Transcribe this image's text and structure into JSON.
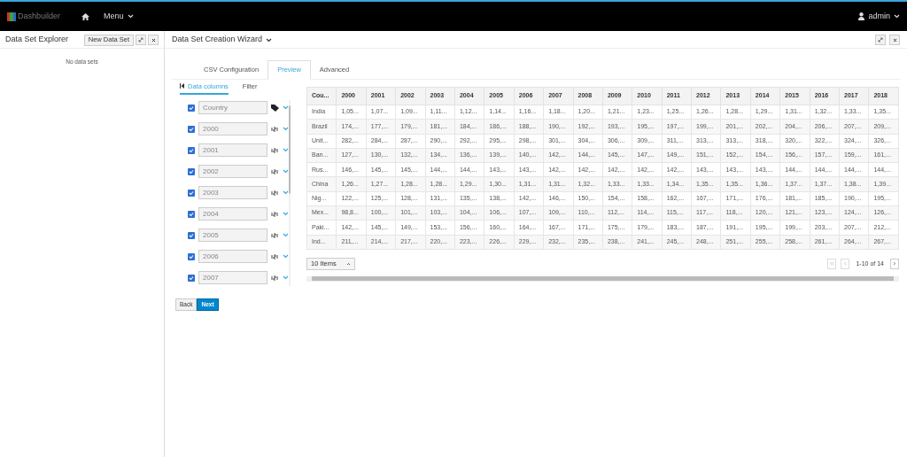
{
  "navbar": {
    "brand": "Dashbuilder",
    "menu": "Menu",
    "user": "admin"
  },
  "explorer": {
    "title": "Data Set Explorer",
    "new_button": "New Data Set",
    "empty": "No data sets"
  },
  "wizard": {
    "title": "Data Set Creation Wizard",
    "tabs": [
      {
        "label": "CSV Configuration",
        "selected": false
      },
      {
        "label": "Preview",
        "selected": true
      },
      {
        "label": "Advanced",
        "selected": false
      }
    ],
    "subtabs": [
      {
        "label": "Data columns",
        "selected": true
      },
      {
        "label": "Filter",
        "selected": false
      }
    ],
    "columns": [
      {
        "name": "Country",
        "kind": "label",
        "checked": true
      },
      {
        "name": "2000",
        "kind": "number",
        "checked": true
      },
      {
        "name": "2001",
        "kind": "number",
        "checked": true
      },
      {
        "name": "2002",
        "kind": "number",
        "checked": true
      },
      {
        "name": "2003",
        "kind": "number",
        "checked": true
      },
      {
        "name": "2004",
        "kind": "number",
        "checked": true
      },
      {
        "name": "2005",
        "kind": "number",
        "checked": true
      },
      {
        "name": "2006",
        "kind": "number",
        "checked": true
      },
      {
        "name": "2007",
        "kind": "number",
        "checked": true
      }
    ],
    "buttons": [
      {
        "label": "Back",
        "kind": "default"
      },
      {
        "label": "Next",
        "kind": "primary"
      }
    ],
    "table": {
      "columns": [
        "Cou...",
        "2000",
        "2001",
        "2002",
        "2003",
        "2004",
        "2005",
        "2006",
        "2007",
        "2008",
        "2009",
        "2010",
        "2011",
        "2012",
        "2013",
        "2014",
        "2015",
        "2016",
        "2017",
        "2018"
      ],
      "rows": [
        [
          "India",
          "1,05...",
          "1,07...",
          "1,09...",
          "1,11...",
          "1,12...",
          "1,14...",
          "1,16...",
          "1,18...",
          "1,20...",
          "1,21...",
          "1,23...",
          "1,25...",
          "1,26...",
          "1,28...",
          "1,29...",
          "1,31...",
          "1,32...",
          "1,33...",
          "1,35..."
        ],
        [
          "Brazil",
          "174,...",
          "177,...",
          "179,...",
          "181,...",
          "184,...",
          "186,...",
          "188,...",
          "190,...",
          "192,...",
          "193,...",
          "195,...",
          "197,...",
          "199,...",
          "201,...",
          "202,...",
          "204,...",
          "206,...",
          "207,...",
          "209,..."
        ],
        [
          "Unit...",
          "282,...",
          "284,...",
          "287,...",
          "290,...",
          "292,...",
          "295,...",
          "298,...",
          "301,...",
          "304,...",
          "306,...",
          "309,...",
          "311,...",
          "313,...",
          "313,...",
          "318,...",
          "320,...",
          "322,...",
          "324,...",
          "326,..."
        ],
        [
          "Ban...",
          "127,...",
          "130,...",
          "132,...",
          "134,...",
          "136,...",
          "139,...",
          "140,...",
          "142,...",
          "144,...",
          "145,...",
          "147,...",
          "149,...",
          "151,...",
          "152,...",
          "154,...",
          "156,...",
          "157,...",
          "159,...",
          "161,..."
        ],
        [
          "Rus...",
          "146,...",
          "145,...",
          "145,...",
          "144,...",
          "144,...",
          "143,...",
          "143,...",
          "142,...",
          "142,...",
          "142,...",
          "142,...",
          "142,...",
          "143,...",
          "143,...",
          "143,...",
          "144,...",
          "144,...",
          "144,...",
          "144,..."
        ],
        [
          "China",
          "1,26...",
          "1,27...",
          "1,28...",
          "1,28...",
          "1,29...",
          "1,30...",
          "1,31...",
          "1,31...",
          "1,32...",
          "1,33...",
          "1,33...",
          "1,34...",
          "1,35...",
          "1,35...",
          "1,36...",
          "1,37...",
          "1,37...",
          "1,38...",
          "1,39..."
        ],
        [
          "Nig...",
          "122,...",
          "125,...",
          "128,...",
          "131,...",
          "135,...",
          "138,...",
          "142,...",
          "146,...",
          "150,...",
          "154,...",
          "158,...",
          "162,...",
          "167,...",
          "171,...",
          "176,...",
          "181,...",
          "185,...",
          "190,...",
          "195,..."
        ],
        [
          "Mex...",
          "98,8...",
          "100,...",
          "101,...",
          "103,...",
          "104,...",
          "106,...",
          "107,...",
          "109,...",
          "110,...",
          "112,...",
          "114,...",
          "115,...",
          "117,...",
          "118,...",
          "120,...",
          "121,...",
          "123,...",
          "124,...",
          "126,..."
        ],
        [
          "Paki...",
          "142,...",
          "145,...",
          "149,...",
          "153,...",
          "156,...",
          "160,...",
          "164,...",
          "167,...",
          "171,...",
          "175,...",
          "179,...",
          "183,...",
          "187,...",
          "191,...",
          "195,...",
          "199,...",
          "203,...",
          "207,...",
          "212,..."
        ],
        [
          "Ind...",
          "211,...",
          "214,...",
          "217,...",
          "220,...",
          "223,...",
          "226,...",
          "229,...",
          "232,...",
          "235,...",
          "238,...",
          "241,...",
          "245,...",
          "248,...",
          "251,...",
          "255,...",
          "258,...",
          "261,...",
          "264,...",
          "267,..."
        ]
      ]
    },
    "page_size": "10 Items",
    "range": "1-10 of 14"
  }
}
